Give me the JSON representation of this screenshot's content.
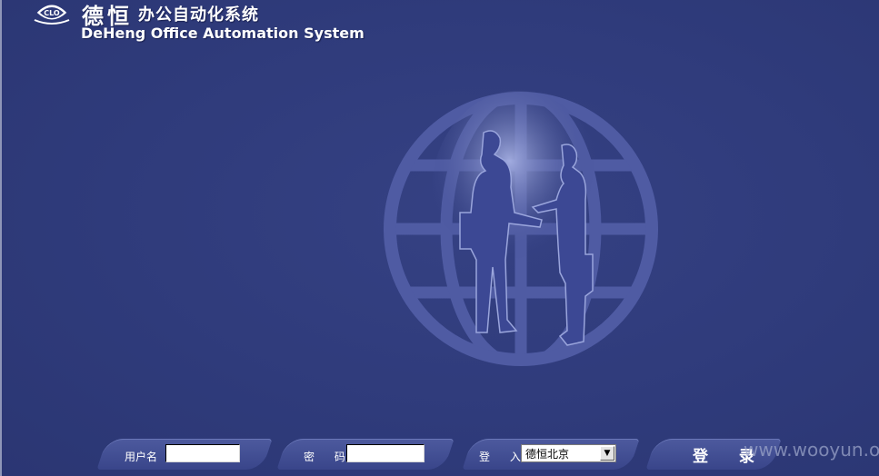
{
  "header": {
    "brand_cn": "德恒",
    "system_cn": "办公自动化系统",
    "system_en": "DeHeng Office Automation System",
    "logo_text": "CLO"
  },
  "login": {
    "username_label": "用户名",
    "username_value": "",
    "password_label": "密 码",
    "password_value": "",
    "login_to_label": "登 入",
    "location_selected": "德恒北京",
    "submit_label": "登 录"
  },
  "watermark": "www.wooyun.org",
  "colors": {
    "background": "#2e3a7a",
    "globe": "#4e5aa0",
    "tab": "#46529a"
  }
}
